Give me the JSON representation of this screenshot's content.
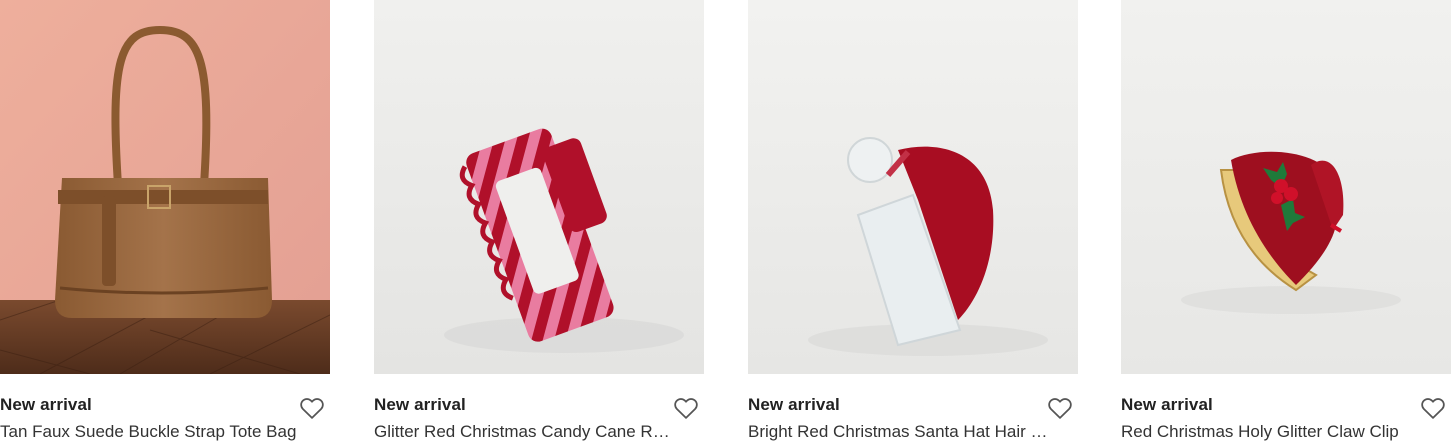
{
  "products": [
    {
      "badge": "New arrival",
      "title": "Tan Faux Suede Buckle Strap Tote Bag",
      "icon": "heart-outline-icon"
    },
    {
      "badge": "New arrival",
      "title": "Glitter Red Christmas Candy Cane Rectangle Claw Clip",
      "icon": "heart-outline-icon"
    },
    {
      "badge": "New arrival",
      "title": "Bright Red Christmas Santa Hat Hair Clip",
      "icon": "heart-outline-icon"
    },
    {
      "badge": "New arrival",
      "title": "Red Christmas Holy Glitter Claw Clip",
      "icon": "heart-outline-icon"
    }
  ],
  "colors": {
    "text": "#222222",
    "heart_stroke": "#555555",
    "bag_bg": "#e9a798",
    "bag": "#9a6a3f",
    "clip_red": "#b0102a",
    "clip_pink": "#e97ca0"
  }
}
